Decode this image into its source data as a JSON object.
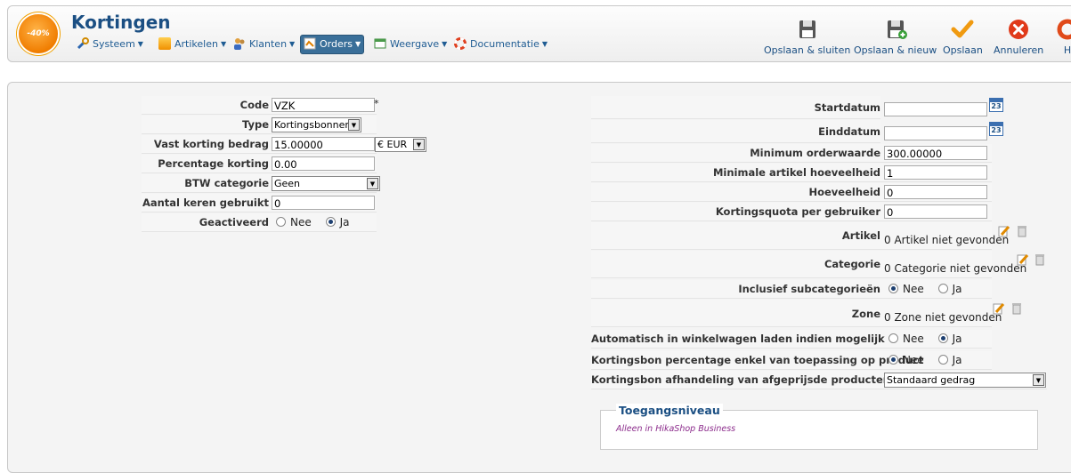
{
  "header": {
    "logo_text": "-40%",
    "title": "Kortingen",
    "menu": [
      {
        "label": "Systeem",
        "icon": "wrench-icon"
      },
      {
        "label": "Artikelen",
        "icon": "box-icon"
      },
      {
        "label": "Klanten",
        "icon": "users-icon"
      },
      {
        "label": "Orders",
        "icon": "orders-icon",
        "active": true
      },
      {
        "label": "Weergave",
        "icon": "display-icon"
      },
      {
        "label": "Documentatie",
        "icon": "lifebuoy-icon"
      }
    ],
    "toolbar": {
      "save_close": "Opslaan & sluiten",
      "save_new": "Opslaan & nieuw",
      "save": "Opslaan",
      "cancel": "Annuleren",
      "help": "H"
    }
  },
  "left_form": {
    "code": {
      "label": "Code",
      "value": "VZK",
      "required": "*"
    },
    "type": {
      "label": "Type",
      "value": "Kortingsbonnen"
    },
    "fixed_amount": {
      "label": "Vast korting bedrag",
      "value": "15.00000",
      "currency": "€ EUR"
    },
    "percentage": {
      "label": "Percentage korting",
      "value": "0.00"
    },
    "tax_category": {
      "label": "BTW categorie",
      "value": "Geen"
    },
    "times_used": {
      "label": "Aantal keren gebruikt",
      "value": "0"
    },
    "published": {
      "label": "Geactiveerd",
      "no": "Nee",
      "yes": "Ja",
      "selected": "yes"
    }
  },
  "right_form": {
    "start_date": {
      "label": "Startdatum",
      "value": ""
    },
    "end_date": {
      "label": "Einddatum",
      "value": ""
    },
    "min_order": {
      "label": "Minimum orderwaarde",
      "value": "300.00000"
    },
    "min_products": {
      "label": "Minimale artikel hoeveelheid",
      "value": "1"
    },
    "quantity": {
      "label": "Hoeveelheid",
      "value": "0"
    },
    "quota_per_user": {
      "label": "Kortingsquota per gebruiker",
      "value": "0"
    },
    "product": {
      "label": "Artikel",
      "value": "0 Artikel niet gevonden"
    },
    "category": {
      "label": "Categorie",
      "value": "0 Categorie niet gevonden"
    },
    "child_categories": {
      "label": "Inclusief subcategorieën",
      "no": "Nee",
      "yes": "Ja",
      "selected": "no"
    },
    "zone": {
      "label": "Zone",
      "value": "0 Zone niet gevonden"
    },
    "auto_load": {
      "label": "Automatisch in winkelwagen laden indien mogelijk",
      "no": "Nee",
      "yes": "Ja",
      "selected": "yes"
    },
    "percent_product_only": {
      "label": "Kortingsbon percentage enkel van toepassing op product",
      "no": "Nee",
      "yes": "Ja",
      "selected": "no"
    },
    "discounted_products": {
      "label": "Kortingsbon afhandeling van afgeprijsde producten",
      "value": "Standaard gedrag"
    }
  },
  "access": {
    "legend": "Toegangsniveau",
    "note": "Alleen in HikaShop Business"
  },
  "calendar_day": "23"
}
